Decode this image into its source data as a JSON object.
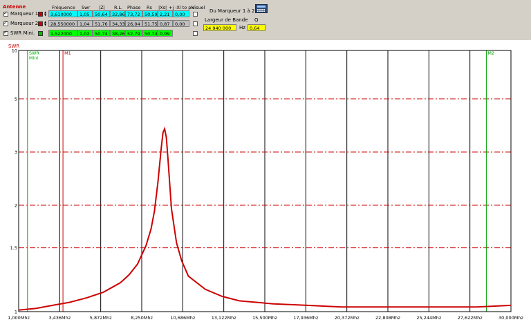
{
  "panel": {
    "antenne_label": "Antenne",
    "headers": [
      "Fréquence",
      "Swr",
      "|Z|",
      "R.L.",
      "Phase",
      "Rs",
      "|Xs|",
      "+j -Xl to pH",
      "Visuel"
    ],
    "markers": [
      {
        "label": "Marqueur 1",
        "checked": true,
        "swatch_color": "#cc0000",
        "row_color": "#00ffff",
        "visuel": false,
        "values": [
          "3,610000",
          "1,05",
          "50,64",
          "32,86",
          "73,72",
          "50,59",
          "2,21",
          "0,00"
        ]
      },
      {
        "label": "Marqueur 2",
        "checked": true,
        "swatch_color": "#cc0000",
        "row_color": "#c0c0c0",
        "visuel": false,
        "values": [
          "28,550000",
          "1,04",
          "51,76",
          "34,33",
          "26,04",
          "51,75",
          "0,87",
          "0,00"
        ]
      },
      {
        "label": "SWR Mini.",
        "checked": true,
        "swatch_color": "#00c000",
        "row_color": "#00ff00",
        "visuel": false,
        "values": [
          "1,522000",
          "1,02",
          "50,74",
          "38,26",
          "52,79",
          "50,74",
          "0,99",
          ""
        ]
      }
    ],
    "du_marqueur_label": "Du Marqueur 1 à 2",
    "largeur_label": "Largeur de Bande",
    "q_label": "Q",
    "bandwidth_value": "24 940 000",
    "hz_label": "Hz",
    "q_value": "0,64",
    "calc_icon": "calculator-icon"
  },
  "chart_data": {
    "type": "line",
    "ylabel": "SWR",
    "y_scale": "swr",
    "ylim": [
      1,
      10
    ],
    "xlim": [
      1.0,
      30.0
    ],
    "y_ticks": [
      "10",
      "5",
      "3",
      "2",
      "1.5",
      "1"
    ],
    "x_ticks": [
      "1,000Mhz",
      "3,436Mhz",
      "5,872Mhz",
      "8,250Mhz",
      "10,686Mhz",
      "13,122Mhz",
      "15,500Mhz",
      "17,936Mhz",
      "20,372Mhz",
      "22,808Mhz",
      "25,244Mhz",
      "27,622Mhz",
      "30,000Mhz"
    ],
    "grid": true,
    "markers": [
      {
        "name": "SWR\nMini",
        "x": 1.522,
        "color": "#00b000"
      },
      {
        "name": "M1",
        "x": 3.61,
        "color": "#cc0000"
      },
      {
        "name": "M2",
        "x": 28.55,
        "color": "#00a000"
      }
    ],
    "series": [
      {
        "color": "#cc0000",
        "x": [
          1.0,
          2.0,
          3.0,
          4.0,
          5.0,
          6.0,
          7.0,
          7.5,
          8.0,
          8.5,
          8.8,
          9.0,
          9.2,
          9.4,
          9.5,
          9.6,
          9.7,
          9.8,
          10.0,
          10.3,
          10.6,
          11.0,
          12.0,
          13.0,
          14.0,
          16.0,
          18.0,
          20.0,
          24.0,
          28.0,
          30.0
        ],
        "y": [
          1.01,
          1.02,
          1.04,
          1.06,
          1.09,
          1.13,
          1.2,
          1.26,
          1.35,
          1.52,
          1.7,
          1.92,
          2.35,
          3.1,
          3.55,
          3.68,
          3.4,
          2.8,
          1.95,
          1.55,
          1.38,
          1.25,
          1.15,
          1.1,
          1.07,
          1.05,
          1.04,
          1.03,
          1.03,
          1.03,
          1.04
        ]
      }
    ]
  }
}
